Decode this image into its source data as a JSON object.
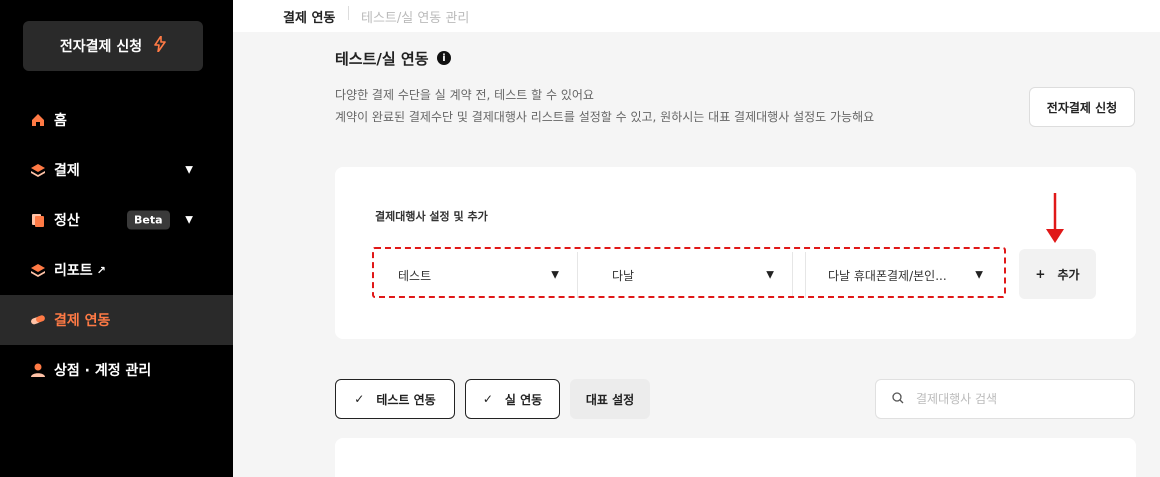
{
  "sidebar": {
    "apply_button": "전자결제 신청",
    "items": [
      {
        "label": "홈"
      },
      {
        "label": "결제"
      },
      {
        "label": "정산",
        "badge": "Beta"
      },
      {
        "label": "리포트"
      },
      {
        "label": "결제 연동"
      },
      {
        "label": "상점 · 계정 관리"
      }
    ]
  },
  "breadcrumb": {
    "first": "결제 연동",
    "second": "테스트/실 연동 관리"
  },
  "main": {
    "title": "테스트/실 연동",
    "desc_line1": "다양한 결제 수단을 실 계약 전, 테스트 할 수 있어요",
    "desc_line2": "계약이 완료된 결제수단 및 결제대행사 리스트를 설정할 수 있고, 원하시는 대표 결제대행사 설정도 가능해요",
    "apply_button": "전자결제 신청"
  },
  "pg_setting": {
    "label": "결제대행사 설정 및 추가",
    "select_mode": "테스트",
    "select_pg": "다날",
    "select_method": "다날 휴대폰결제/본인...",
    "add_button": "추가"
  },
  "filters": {
    "test_chip": "테스트 연동",
    "live_chip": "실 연동",
    "primary_chip": "대표 설정",
    "search_placeholder": "결제대행사 검색"
  },
  "colors": {
    "accent": "#ff7a45",
    "highlight_red": "#e01818",
    "sidebar_bg": "#000000"
  }
}
